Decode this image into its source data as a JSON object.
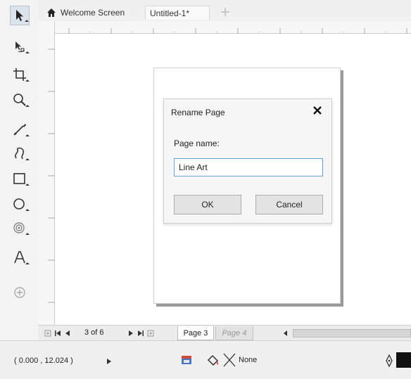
{
  "tabs": {
    "welcome": "Welcome Screen",
    "document": "Untitled-1*"
  },
  "toolbox": {
    "tools": [
      {
        "name": "pick-tool",
        "icon": "pointer-arrow-icon"
      },
      {
        "name": "shape-tool",
        "icon": "node-arrow-icon"
      },
      {
        "name": "crop-tool",
        "icon": "crop-icon"
      },
      {
        "name": "zoom-tool",
        "icon": "magnifier-icon"
      },
      {
        "name": "freehand-tool",
        "icon": "freehand-pen-icon"
      },
      {
        "name": "artistic-media-tool",
        "icon": "brush-curve-icon"
      },
      {
        "name": "rectangle-tool",
        "icon": "rectangle-icon"
      },
      {
        "name": "ellipse-tool",
        "icon": "ellipse-icon"
      },
      {
        "name": "polygon-tool",
        "icon": "spiral-icon"
      },
      {
        "name": "text-tool",
        "icon": "text-a-icon"
      },
      {
        "name": "add-tool",
        "icon": "plus-circle-icon"
      }
    ]
  },
  "dialog": {
    "title": "Rename Page",
    "field_label": "Page name:",
    "input_value": "Line Art",
    "ok_label": "OK",
    "cancel_label": "Cancel"
  },
  "page_nav": {
    "counter": "3 of 6",
    "current_tab": "Page 3",
    "next_tab": "Page 4"
  },
  "status": {
    "coordinates": "( 0.000 , 12.024 )",
    "fill_label": "None"
  },
  "colors": {
    "accent": "#6aa3d6",
    "toolbar_bg": "#f3f3f3",
    "page_bg": "#ffffff"
  }
}
